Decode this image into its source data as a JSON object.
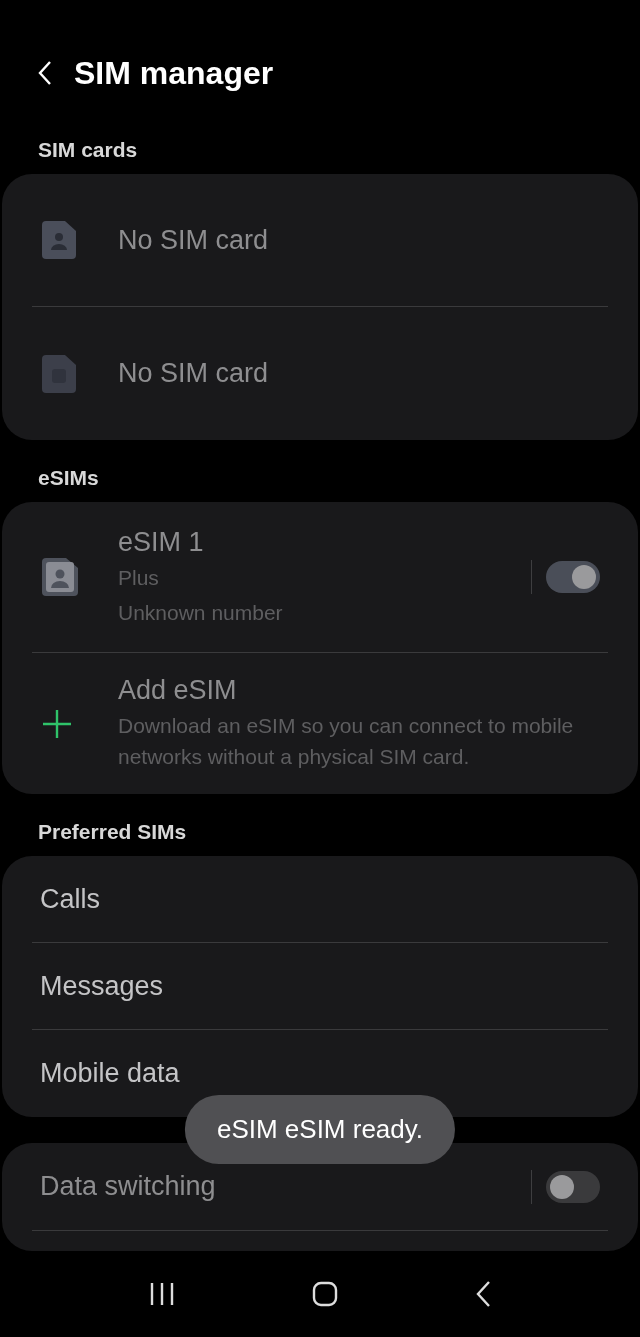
{
  "title": "SIM manager",
  "sections": [
    {
      "label": "SIM cards",
      "items": [
        {
          "kind": "sim",
          "title": "No SIM card",
          "disabled": true
        },
        {
          "kind": "sim",
          "title": "No SIM card",
          "disabled": true
        }
      ]
    },
    {
      "label": "eSIMs",
      "items": [
        {
          "kind": "esim",
          "title": "eSIM 1",
          "lines": [
            "Plus",
            "Unknown number"
          ],
          "on": true,
          "disabled": true
        },
        {
          "kind": "add",
          "title": "Add eSIM",
          "description": "Download an eSIM so you can connect to mobile networks without a physical SIM card.",
          "disabled": true
        }
      ]
    },
    {
      "label": "Preferred SIMs",
      "items": [
        {
          "kind": "plain",
          "title": "Calls",
          "disabled": false
        },
        {
          "kind": "plain",
          "title": "Messages",
          "disabled": false
        },
        {
          "kind": "plain",
          "title": "Mobile data",
          "disabled": false
        }
      ]
    },
    {
      "items": [
        {
          "kind": "toggle",
          "title": "Data switching",
          "on": false,
          "disabled": true
        }
      ]
    }
  ],
  "toast": "eSIM eSIM ready."
}
